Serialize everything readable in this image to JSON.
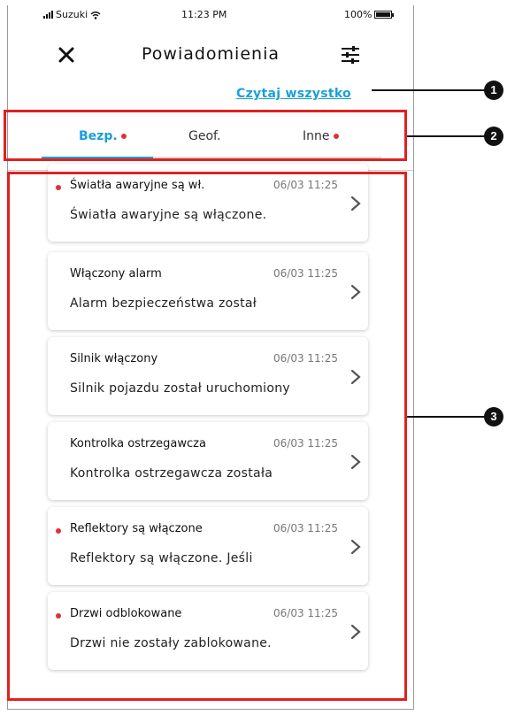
{
  "status_bar": {
    "carrier": "Suzuki",
    "time": "11:23 PM",
    "battery": "100%",
    "battery_level": 1.0
  },
  "header": {
    "title": "Powiadomienia"
  },
  "actions": {
    "read_all": "Czytaj wszystko"
  },
  "tabs": [
    {
      "label": "Bezp.",
      "active": true,
      "has_unread": true
    },
    {
      "label": "Geof.",
      "active": false,
      "has_unread": false
    },
    {
      "label": "Inne",
      "active": false,
      "has_unread": true
    }
  ],
  "notifications": [
    {
      "title": "Światła awaryjne są wł.",
      "time": "06/03 11:25",
      "body": "Światła awaryjne są włączone.",
      "unread": true
    },
    {
      "title": "Włączony alarm",
      "time": "06/03 11:25",
      "body": "Alarm bezpieczeństwa został",
      "unread": false
    },
    {
      "title": "Silnik włączony",
      "time": "06/03 11:25",
      "body": "Silnik pojazdu został uruchomiony",
      "unread": false
    },
    {
      "title": "Kontrolka ostrzegawcza",
      "time": "06/03 11:25",
      "body": "Kontrolka ostrzegawcza została",
      "unread": false
    },
    {
      "title": "Reflektory są włączone",
      "time": "06/03 11:25",
      "body": "Reflektory są włączone. Jeśli",
      "unread": true
    },
    {
      "title": "Drzwi odblokowane",
      "time": "06/03 11:25",
      "body": "Drzwi nie zostały zablokowane.",
      "unread": true
    }
  ],
  "callouts": [
    "1",
    "2",
    "3"
  ],
  "colors": {
    "accent": "#1aa0d8",
    "unread_dot": "#e0303a",
    "highlight": "#e02020"
  }
}
